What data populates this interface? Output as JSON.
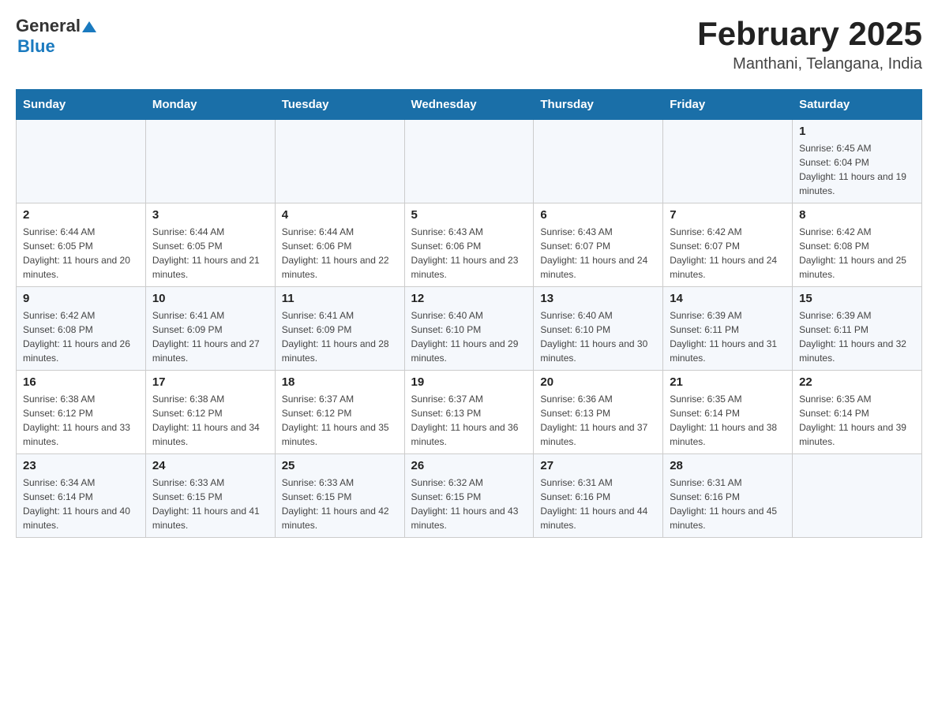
{
  "logo": {
    "general": "General",
    "blue": "Blue"
  },
  "title": "February 2025",
  "subtitle": "Manthani, Telangana, India",
  "days_of_week": [
    "Sunday",
    "Monday",
    "Tuesday",
    "Wednesday",
    "Thursday",
    "Friday",
    "Saturday"
  ],
  "weeks": [
    [
      {
        "day": "",
        "info": ""
      },
      {
        "day": "",
        "info": ""
      },
      {
        "day": "",
        "info": ""
      },
      {
        "day": "",
        "info": ""
      },
      {
        "day": "",
        "info": ""
      },
      {
        "day": "",
        "info": ""
      },
      {
        "day": "1",
        "info": "Sunrise: 6:45 AM\nSunset: 6:04 PM\nDaylight: 11 hours and 19 minutes."
      }
    ],
    [
      {
        "day": "2",
        "info": "Sunrise: 6:44 AM\nSunset: 6:05 PM\nDaylight: 11 hours and 20 minutes."
      },
      {
        "day": "3",
        "info": "Sunrise: 6:44 AM\nSunset: 6:05 PM\nDaylight: 11 hours and 21 minutes."
      },
      {
        "day": "4",
        "info": "Sunrise: 6:44 AM\nSunset: 6:06 PM\nDaylight: 11 hours and 22 minutes."
      },
      {
        "day": "5",
        "info": "Sunrise: 6:43 AM\nSunset: 6:06 PM\nDaylight: 11 hours and 23 minutes."
      },
      {
        "day": "6",
        "info": "Sunrise: 6:43 AM\nSunset: 6:07 PM\nDaylight: 11 hours and 24 minutes."
      },
      {
        "day": "7",
        "info": "Sunrise: 6:42 AM\nSunset: 6:07 PM\nDaylight: 11 hours and 24 minutes."
      },
      {
        "day": "8",
        "info": "Sunrise: 6:42 AM\nSunset: 6:08 PM\nDaylight: 11 hours and 25 minutes."
      }
    ],
    [
      {
        "day": "9",
        "info": "Sunrise: 6:42 AM\nSunset: 6:08 PM\nDaylight: 11 hours and 26 minutes."
      },
      {
        "day": "10",
        "info": "Sunrise: 6:41 AM\nSunset: 6:09 PM\nDaylight: 11 hours and 27 minutes."
      },
      {
        "day": "11",
        "info": "Sunrise: 6:41 AM\nSunset: 6:09 PM\nDaylight: 11 hours and 28 minutes."
      },
      {
        "day": "12",
        "info": "Sunrise: 6:40 AM\nSunset: 6:10 PM\nDaylight: 11 hours and 29 minutes."
      },
      {
        "day": "13",
        "info": "Sunrise: 6:40 AM\nSunset: 6:10 PM\nDaylight: 11 hours and 30 minutes."
      },
      {
        "day": "14",
        "info": "Sunrise: 6:39 AM\nSunset: 6:11 PM\nDaylight: 11 hours and 31 minutes."
      },
      {
        "day": "15",
        "info": "Sunrise: 6:39 AM\nSunset: 6:11 PM\nDaylight: 11 hours and 32 minutes."
      }
    ],
    [
      {
        "day": "16",
        "info": "Sunrise: 6:38 AM\nSunset: 6:12 PM\nDaylight: 11 hours and 33 minutes."
      },
      {
        "day": "17",
        "info": "Sunrise: 6:38 AM\nSunset: 6:12 PM\nDaylight: 11 hours and 34 minutes."
      },
      {
        "day": "18",
        "info": "Sunrise: 6:37 AM\nSunset: 6:12 PM\nDaylight: 11 hours and 35 minutes."
      },
      {
        "day": "19",
        "info": "Sunrise: 6:37 AM\nSunset: 6:13 PM\nDaylight: 11 hours and 36 minutes."
      },
      {
        "day": "20",
        "info": "Sunrise: 6:36 AM\nSunset: 6:13 PM\nDaylight: 11 hours and 37 minutes."
      },
      {
        "day": "21",
        "info": "Sunrise: 6:35 AM\nSunset: 6:14 PM\nDaylight: 11 hours and 38 minutes."
      },
      {
        "day": "22",
        "info": "Sunrise: 6:35 AM\nSunset: 6:14 PM\nDaylight: 11 hours and 39 minutes."
      }
    ],
    [
      {
        "day": "23",
        "info": "Sunrise: 6:34 AM\nSunset: 6:14 PM\nDaylight: 11 hours and 40 minutes."
      },
      {
        "day": "24",
        "info": "Sunrise: 6:33 AM\nSunset: 6:15 PM\nDaylight: 11 hours and 41 minutes."
      },
      {
        "day": "25",
        "info": "Sunrise: 6:33 AM\nSunset: 6:15 PM\nDaylight: 11 hours and 42 minutes."
      },
      {
        "day": "26",
        "info": "Sunrise: 6:32 AM\nSunset: 6:15 PM\nDaylight: 11 hours and 43 minutes."
      },
      {
        "day": "27",
        "info": "Sunrise: 6:31 AM\nSunset: 6:16 PM\nDaylight: 11 hours and 44 minutes."
      },
      {
        "day": "28",
        "info": "Sunrise: 6:31 AM\nSunset: 6:16 PM\nDaylight: 11 hours and 45 minutes."
      },
      {
        "day": "",
        "info": ""
      }
    ]
  ]
}
